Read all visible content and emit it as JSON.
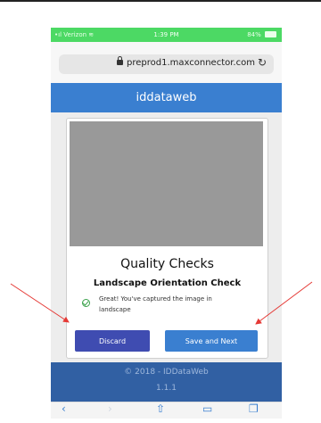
{
  "status_bar": {
    "carrier": "Verizon",
    "time": "1:39 PM",
    "battery": "84%"
  },
  "browser": {
    "url": "preprod1.maxconnector.com"
  },
  "header": {
    "title": "iddataweb"
  },
  "card": {
    "title": "Quality Checks",
    "subtitle": "Landscape Orientation Check",
    "message": "Great! You've captured the image in landscape"
  },
  "buttons": {
    "discard": "Discard",
    "save_next": "Save and Next"
  },
  "footer": {
    "copyright": "© 2018 - IDDataWeb",
    "version": "1.1.1"
  },
  "toolbar": {
    "back_icon": "chevron-left-icon",
    "forward_icon": "chevron-right-icon",
    "share_icon": "share-icon",
    "bookmarks_icon": "book-icon",
    "tabs_icon": "tabs-icon"
  },
  "colors": {
    "status_green": "#4cd964",
    "header_blue": "#3a7fd0",
    "discard_button": "#3f4cb1",
    "footer_blue": "#3160a3",
    "annotation_arrow": "#e53935"
  }
}
